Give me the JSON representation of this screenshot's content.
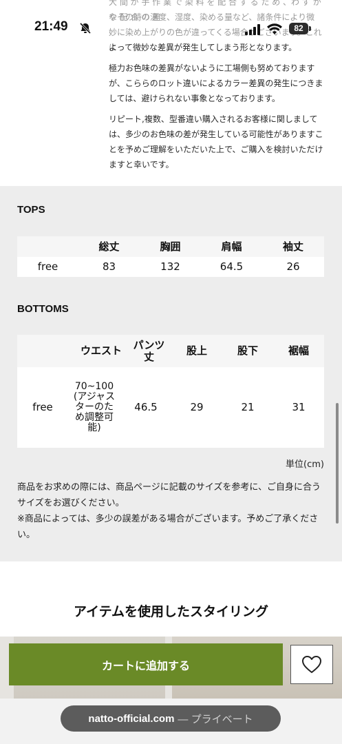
{
  "status_bar": {
    "time": "21:49",
    "battery": "82"
  },
  "intro": {
    "faded_lines": [
      "大 間 が 手 作 業 で 染 料 を 配 合 す る た め 、わ ず か な 配 合 の 差",
      "やその時の温度、湿度、染める量など、諸条件により微",
      "妙に染め上がりの色が違ってくる場合がございます。これに"
    ],
    "line4": "よって微妙な差異が発生してしまう形となります。",
    "para2": "極力お色味の差異がないように工場側も努めております が、こららのロット違いによるカラー差異の発生につきましては、避けられない事象となっております。",
    "para3": "リピート,複数、型番違い購入されるお客様に関しましては、多少のお色味の差が発生している可能性がありますことを予めご理解をいただいた上で、ご購入を検討いただけますと幸いです。"
  },
  "tops": {
    "title": "TOPS",
    "headers": [
      "",
      "総丈",
      "胸囲",
      "肩幅",
      "袖丈"
    ],
    "rows": [
      [
        "free",
        "83",
        "132",
        "64.5",
        "26"
      ]
    ]
  },
  "bottoms": {
    "title": "BOTTOMS",
    "headers": [
      "",
      "ウエスト",
      "パンツ丈",
      "股上",
      "股下",
      "裾幅"
    ],
    "rows": [
      [
        "free",
        "70~100(アジャスターのため調整可能)",
        "46.5",
        "29",
        "21",
        "31"
      ]
    ]
  },
  "unit": "単位(cm)",
  "note": {
    "line1": "商品をお求めの際には、商品ページに記載のサイズを参考に、ご自身に合うサイズをお選びください。",
    "line2": "※商品によっては、多少の誤差がある場合がございます。予めご了承ください。"
  },
  "styling_title": "アイテムを使用したスタイリング",
  "cart_button": "カートに追加する",
  "url_bar": {
    "domain": "natto-official.com",
    "suffix": "— プライベート"
  }
}
